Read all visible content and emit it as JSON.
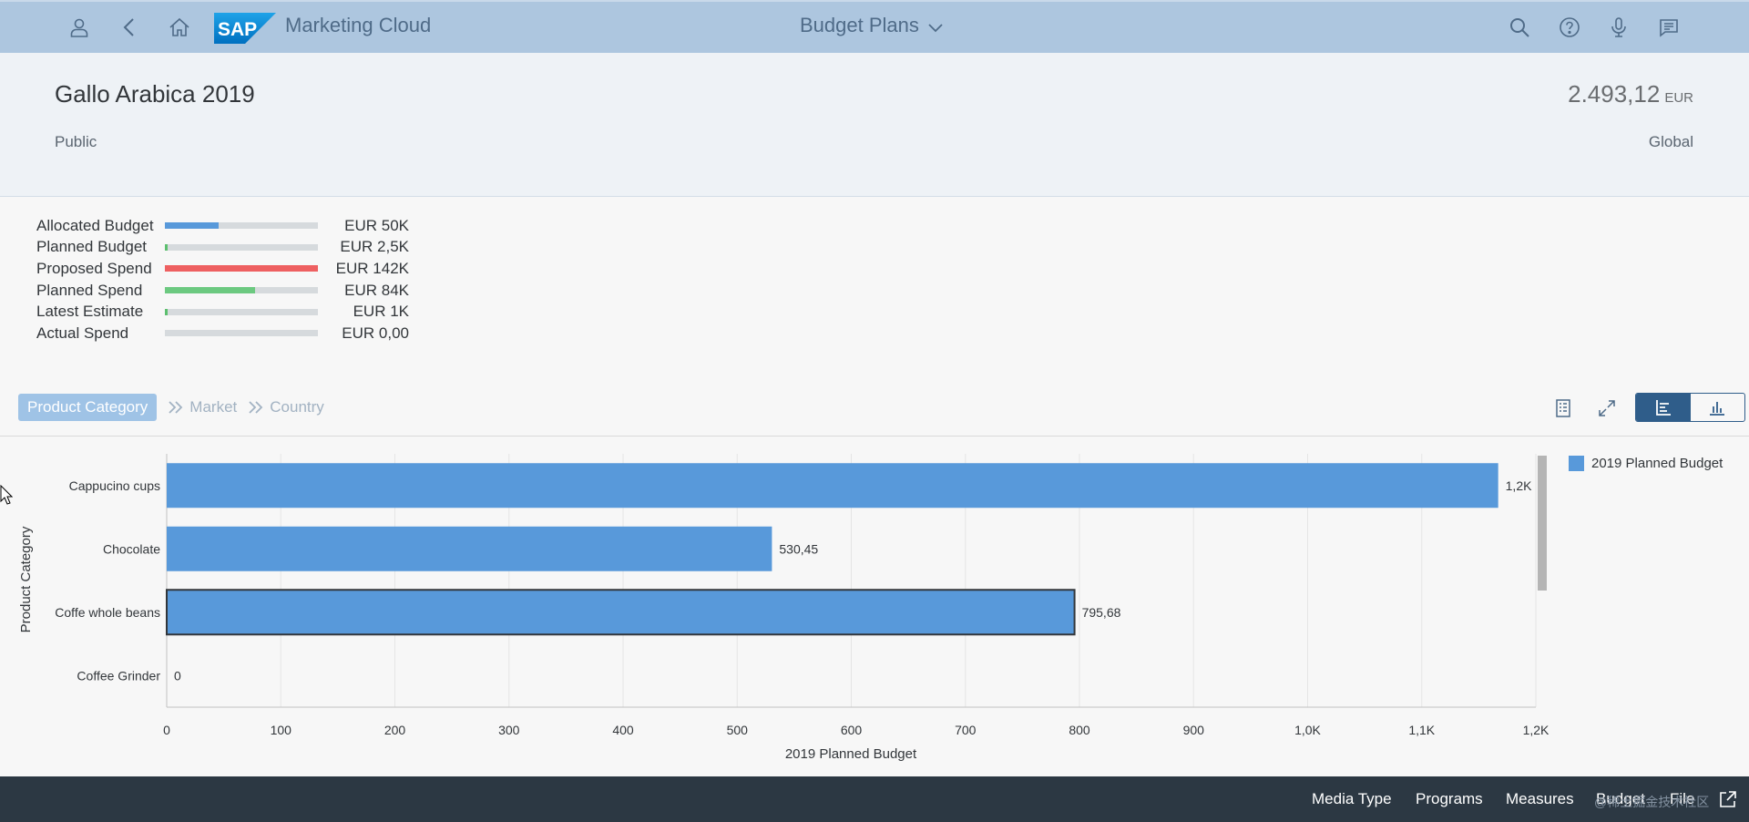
{
  "shell": {
    "app_name": "Marketing Cloud",
    "logo_text": "SAP",
    "center_title": "Budget Plans"
  },
  "header": {
    "title": "Gallo Arabica 2019",
    "visibility": "Public",
    "amount": "2.493,12",
    "currency": "EUR",
    "scope": "Global"
  },
  "budget_bars": [
    {
      "label": "Allocated Budget",
      "value": "EUR 50K",
      "fill": 0.35,
      "color": "#5899da"
    },
    {
      "label": "Planned Budget",
      "value": "EUR 2,5K",
      "fill": 0.02,
      "color": "#5cbf6e"
    },
    {
      "label": "Proposed Spend",
      "value": "EUR 142K",
      "fill": 1.0,
      "color": "#ee6061"
    },
    {
      "label": "Planned Spend",
      "value": "EUR 84K",
      "fill": 0.59,
      "color": "#6cc980"
    },
    {
      "label": "Latest Estimate",
      "value": "EUR 1K",
      "fill": 0.02,
      "color": "#5cbf6e"
    },
    {
      "label": "Actual Spend",
      "value": "EUR 0,00",
      "fill": 0.0,
      "color": "#5899da"
    }
  ],
  "drilldown": {
    "active": "Product Category",
    "items": [
      "Market",
      "Country"
    ]
  },
  "chart_data": {
    "type": "bar",
    "orientation": "horizontal",
    "categories": [
      "Cappucino cups",
      "Chocolate",
      "Coffe whole beans",
      "Coffee Grinder"
    ],
    "values": [
      1166.99,
      530.45,
      795.68,
      0
    ],
    "data_labels": [
      "1,2K",
      "530,45",
      "795,68",
      "0"
    ],
    "ylabel": "Product Category",
    "xlabel": "2019 Planned Budget",
    "xlim": [
      0,
      1200
    ],
    "x_ticks": [
      0,
      100,
      200,
      300,
      400,
      500,
      600,
      700,
      800,
      900,
      1000,
      1100,
      1200
    ],
    "x_tick_labels": [
      "0",
      "100",
      "200",
      "300",
      "400",
      "500",
      "600",
      "700",
      "800",
      "900",
      "1,0K",
      "1,1K",
      "1,2K"
    ],
    "legend": [
      "2019 Planned Budget"
    ],
    "legend_position": "right",
    "grid": true,
    "bar_color": "#5899da",
    "selected_index": 2
  },
  "footer": {
    "buttons": [
      "Media Type",
      "Programs",
      "Measures",
      "Budget",
      "File"
    ],
    "watermark": "@稀土掘金技术社区"
  }
}
